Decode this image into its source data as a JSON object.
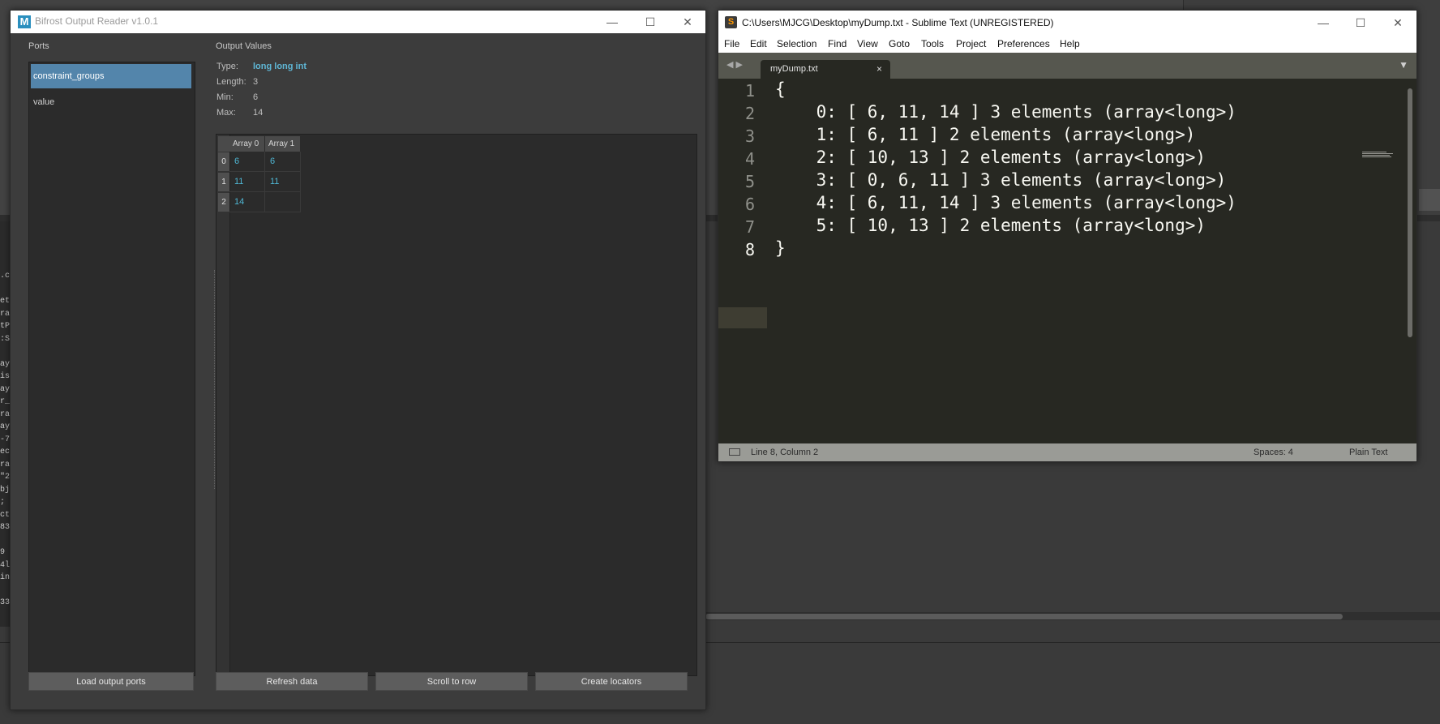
{
  "bifrost": {
    "title": "Bifrost Output Reader v1.0.1",
    "icon_letter": "M",
    "window_controls": {
      "minimize": "—",
      "maximize": "☐",
      "close": "✕"
    },
    "ports_label": "Ports",
    "ports": [
      "constraint_groups",
      "value"
    ],
    "selected_port": "constraint_groups",
    "output_values_label": "Output Values",
    "info": {
      "type_label": "Type:",
      "type_value": "long long int",
      "length_label": "Length:",
      "length_value": "3",
      "min_label": "Min:",
      "min_value": "6",
      "max_label": "Max:",
      "max_value": "14"
    },
    "table": {
      "columns": [
        "Array 0",
        "Array 1"
      ],
      "row_headers": [
        "0",
        "1",
        "2"
      ],
      "rows": [
        [
          "6",
          "6"
        ],
        [
          "11",
          "11"
        ],
        [
          "14",
          ""
        ]
      ]
    },
    "buttons": {
      "load_ports": "Load output ports",
      "refresh": "Refresh data",
      "scroll_to_row": "Scroll to row",
      "create_locators": "Create locators"
    }
  },
  "sublime": {
    "title": "C:\\Users\\MJCG\\Desktop\\myDump.txt - Sublime Text (UNREGISTERED)",
    "icon_letter": "S",
    "window_controls": {
      "minimize": "—",
      "maximize": "☐",
      "close": "✕"
    },
    "menu": [
      "File",
      "Edit",
      "Selection",
      "Find",
      "View",
      "Goto",
      "Tools",
      "Project",
      "Preferences",
      "Help"
    ],
    "tab_name": "myDump.txt",
    "tab_close": "×",
    "nav_arrows": "◀ ▶",
    "tab_dropdown": "▼",
    "line_numbers": [
      "1",
      "2",
      "3",
      "4",
      "5",
      "6",
      "7",
      "8"
    ],
    "lines": [
      "{",
      "    0: [ 6, 11, 14 ] 3 elements (array<long>)",
      "    1: [ 6, 11 ] 2 elements (array<long>)",
      "    2: [ 10, 13 ] 2 elements (array<long>)",
      "    3: [ 0, 6, 11 ] 3 elements (array<long>)",
      "    4: [ 6, 11, 14 ] 3 elements (array<long>)",
      "    5: [ 10, 13 ] 2 elements (array<long>)",
      "}"
    ],
    "status": {
      "position": "Line 8, Column 2",
      "spaces": "Spaces: 4",
      "syntax": "Plain Text"
    }
  },
  "background_code": ".c\n\net\nra\ntP\n:S\n\nay\nis\nay\nr_\nra\nay\n-7\nec\nra\n\"2\nbj\n;\nct\n83\n\n9\n4l\nin\n\n33"
}
